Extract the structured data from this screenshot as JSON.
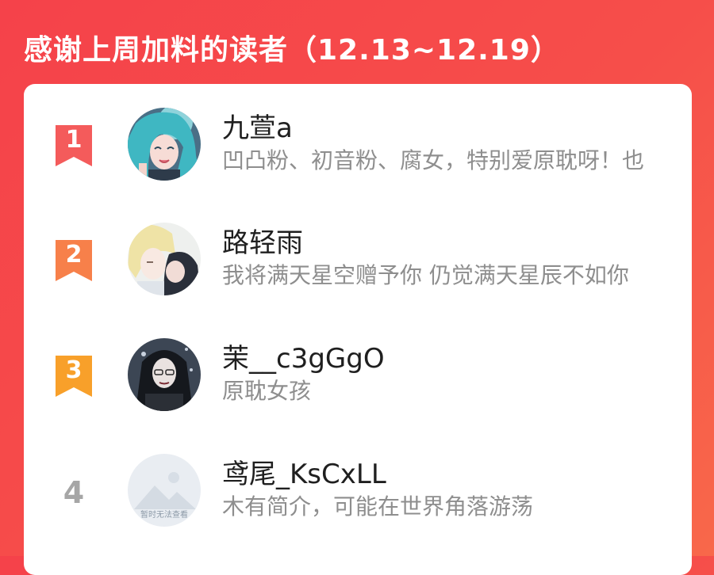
{
  "header": {
    "title": "感谢上周加料的读者（12.13~12.19）"
  },
  "colors": {
    "background": "#f5424a",
    "rank1": "#f45b5b",
    "rank2": "#f7804a",
    "rank3": "#f8a02a",
    "rank_other": "#a6a6a6"
  },
  "readers": [
    {
      "rank": "1",
      "name": "九萱a",
      "bio": "凹凸粉、初音粉、腐女，特别爱原耽呀！也",
      "avatar_icon": "anime-girl-avatar"
    },
    {
      "rank": "2",
      "name": "路轻雨",
      "bio": "我将满天星空赠予你 仍觉满天星辰不如你",
      "avatar_icon": "anime-couple-avatar"
    },
    {
      "rank": "3",
      "name": "茉__c3gGgO",
      "bio": "原耽女孩",
      "avatar_icon": "dark-haired-girl-avatar"
    },
    {
      "rank": "4",
      "name": "鸢尾_KsCxLL",
      "bio": "木有简介，可能在世界角落游荡",
      "avatar_icon": "placeholder-avatar",
      "avatar_placeholder": "暂时无法查看"
    }
  ]
}
